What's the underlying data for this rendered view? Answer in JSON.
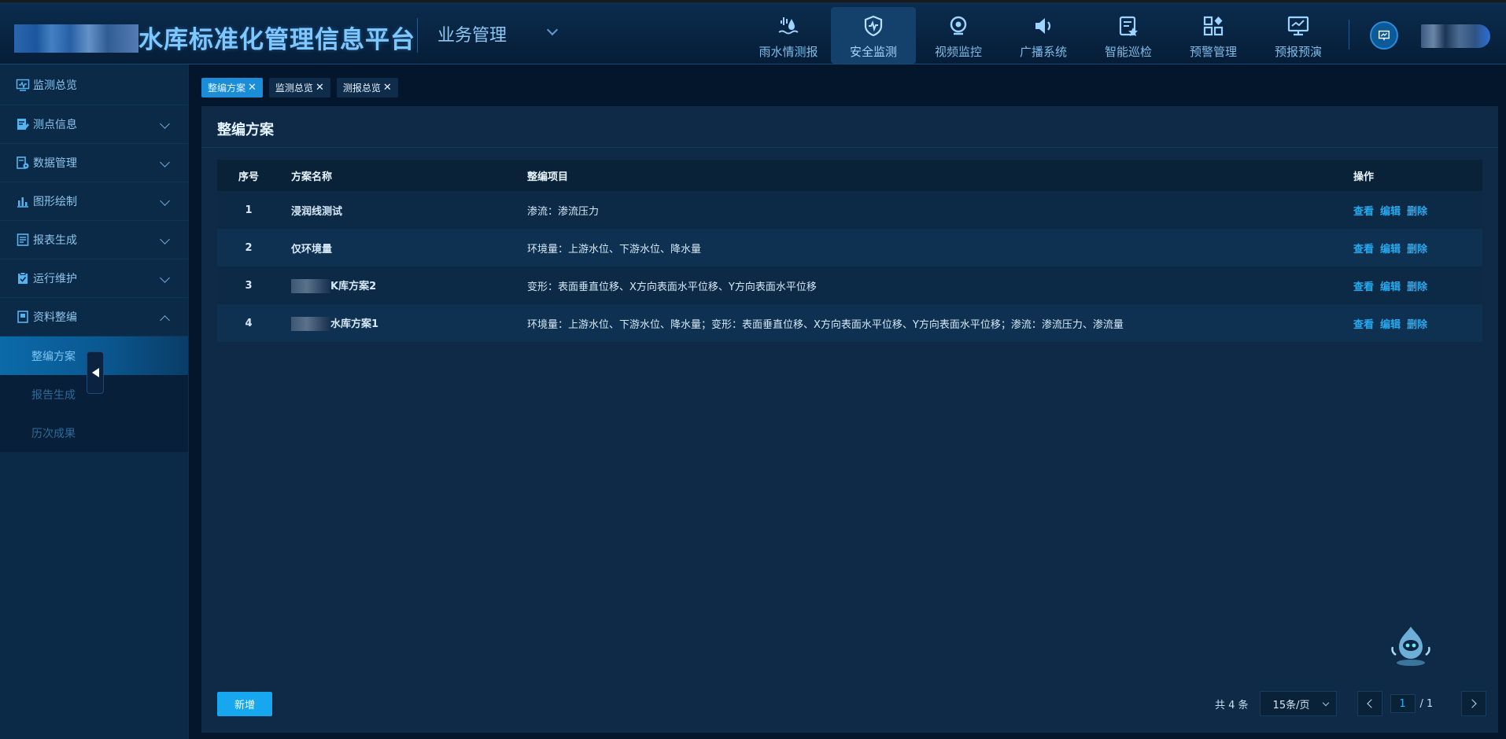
{
  "header": {
    "app_title": "水库标准化管理信息平台",
    "section": "业务管理",
    "nav": [
      {
        "label": "雨水情测报",
        "icon": "rain-water-icon",
        "active": false
      },
      {
        "label": "安全监测",
        "icon": "shield-heartbeat-icon",
        "active": true
      },
      {
        "label": "视频监控",
        "icon": "webcam-icon",
        "active": false
      },
      {
        "label": "广播系统",
        "icon": "speaker-icon",
        "active": false
      },
      {
        "label": "智能巡检",
        "icon": "inspection-doc-icon",
        "active": false
      },
      {
        "label": "预警管理",
        "icon": "grid-apps-icon",
        "active": false
      },
      {
        "label": "预报预演",
        "icon": "monitor-chart-icon",
        "active": false
      }
    ]
  },
  "sidebar": {
    "items": [
      {
        "label": "监测总览",
        "icon": "monitor-wave-icon"
      },
      {
        "label": "测点信息",
        "icon": "doc-edit-icon"
      },
      {
        "label": "数据管理",
        "icon": "data-settings-icon"
      },
      {
        "label": "图形绘制",
        "icon": "bar-chart-icon"
      },
      {
        "label": "报表生成",
        "icon": "report-icon"
      },
      {
        "label": "运行维护",
        "icon": "clipboard-check-icon"
      },
      {
        "label": "资料整编",
        "icon": "book-icon"
      }
    ],
    "sub_items": [
      {
        "label": "整编方案",
        "active": true
      },
      {
        "label": "报告生成",
        "active": false
      },
      {
        "label": "历次成果",
        "active": false
      }
    ]
  },
  "tags": [
    {
      "label": "整编方案",
      "active": true
    },
    {
      "label": "监测总览",
      "active": false
    },
    {
      "label": "测报总览",
      "active": false
    }
  ],
  "panel": {
    "title": "整编方案",
    "columns": [
      "序号",
      "方案名称",
      "整编项目",
      "操作"
    ],
    "rows": [
      {
        "idx": "1",
        "name": "浸润线测试",
        "items": "渗流：渗流压力"
      },
      {
        "idx": "2",
        "name": "仅环境量",
        "items": "环境量：上游水位、下游水位、降水量"
      },
      {
        "idx": "3",
        "name": "K库方案2",
        "items": "变形：表面垂直位移、X方向表面水平位移、Y方向表面水平位移"
      },
      {
        "idx": "4",
        "name": "水库方案1",
        "items": "环境量：上游水位、下游水位、降水量；变形：表面垂直位移、X方向表面水平位移、Y方向表面水平位移；渗流：渗流压力、渗流量"
      }
    ],
    "ops": {
      "view": "查看",
      "edit": "编辑",
      "delete": "删除"
    }
  },
  "footer": {
    "add_label": "新增",
    "total": "共 4 条",
    "page_size": "15条/页",
    "current_page": "1",
    "page_total": "/ 1"
  },
  "colors": {
    "accent": "#17a7ef",
    "link": "#27a9ee",
    "header_bg": "#082441",
    "panel_bg": "#0e2a46"
  }
}
